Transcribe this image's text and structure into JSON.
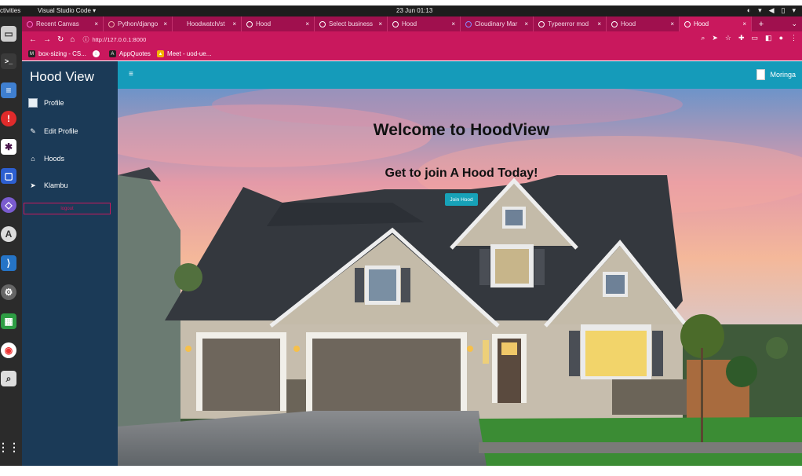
{
  "system": {
    "activities": "ctivities",
    "app": "Visual Studio Code ▾",
    "clock": "23 Jun  01:13"
  },
  "browser": {
    "tabs": [
      {
        "label": "Recent Canvas",
        "active": false
      },
      {
        "label": "Python/django",
        "active": false
      },
      {
        "label": "Hoodwatch/st",
        "active": false
      },
      {
        "label": "Hood",
        "active": false
      },
      {
        "label": "Select business",
        "active": false
      },
      {
        "label": "Hood",
        "active": false
      },
      {
        "label": "Cloudinary Mar",
        "active": false
      },
      {
        "label": "Typeerror mod",
        "active": false
      },
      {
        "label": "Hood",
        "active": false
      },
      {
        "label": "Hood",
        "active": true
      }
    ],
    "url": "http://127.0.0.1:8000",
    "bookmarks": [
      "box-sizing - CS...",
      "",
      "AppQuotes",
      "Meet - uod-ue..."
    ],
    "colors": {
      "tabbar": "#a0104e",
      "toolbar": "#c9185d"
    }
  },
  "sidebar": {
    "brand": "Hood View",
    "items": [
      {
        "label": "Profile",
        "icon": "image-icon"
      },
      {
        "label": "Edit Profile",
        "icon": "edit-icon"
      },
      {
        "label": "Hoods",
        "icon": "home-icon"
      },
      {
        "label": "Klambu",
        "icon": "send-icon"
      }
    ],
    "logout": "logout"
  },
  "header": {
    "user": "Moringa",
    "color": "#159bba"
  },
  "hero": {
    "title": "Welcome to HoodView",
    "subtitle": "Get to join A Hood Today!",
    "button": "Join Hood"
  }
}
